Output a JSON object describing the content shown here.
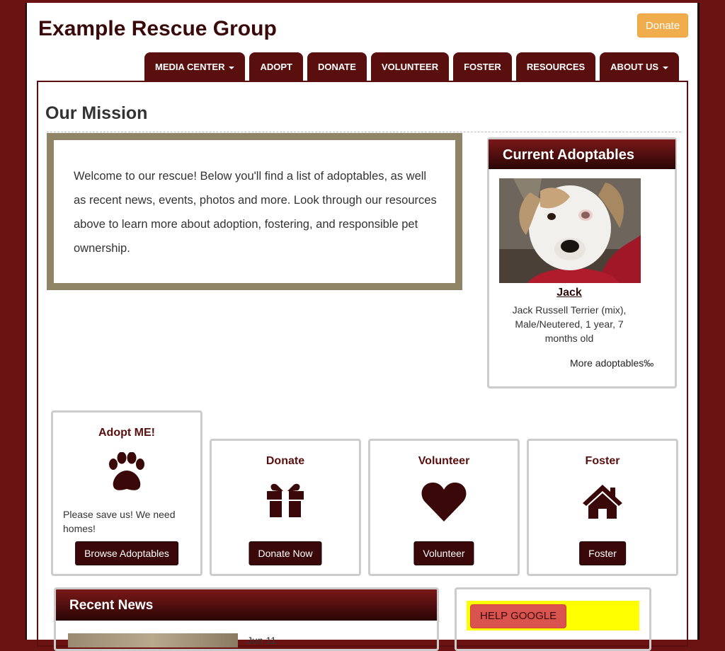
{
  "site": {
    "title": "Example Rescue Group",
    "donate_label": "Donate"
  },
  "nav": [
    {
      "label": "MEDIA CENTER",
      "dropdown": true
    },
    {
      "label": "ADOPT",
      "dropdown": false
    },
    {
      "label": "DONATE",
      "dropdown": false
    },
    {
      "label": "VOLUNTEER",
      "dropdown": false
    },
    {
      "label": "FOSTER",
      "dropdown": false
    },
    {
      "label": "RESOURCES",
      "dropdown": false
    },
    {
      "label": "ABOUT US",
      "dropdown": true
    }
  ],
  "mission": {
    "title": "Our Mission",
    "text": "Welcome to our rescue! Below you'll find a list of adoptables, as well as recent news, events, photos and more. Look through our resources above to learn more about adoption, fostering, and responsible pet ownership."
  },
  "adoptables": {
    "title": "Current Adoptables",
    "pet": {
      "name": "Jack",
      "description": "Jack Russell Terrier (mix), Male/Neutered, 1 year, 7 months old"
    },
    "more_label": "More adoptables‰"
  },
  "cards": [
    {
      "title": "Adopt ME!",
      "icon": "paw-icon",
      "text": "Please save us! We need homes!",
      "button": "Browse Adoptables"
    },
    {
      "title": "Donate",
      "icon": "gift-icon",
      "text": "",
      "button": "Donate Now"
    },
    {
      "title": "Volunteer",
      "icon": "heart-icon",
      "text": "",
      "button": "Volunteer"
    },
    {
      "title": "Foster",
      "icon": "home-icon",
      "text": "",
      "button": "Foster"
    }
  ],
  "news": {
    "title": "Recent News",
    "date_partial": "Jun 11"
  },
  "help": {
    "button": "HELP GOOGLE"
  },
  "colors": {
    "brand": "#5a0f0f",
    "background": "#6b1212",
    "donate": "#f0ad4e",
    "help_bg": "#ffff00",
    "help_btn": "#d9534f"
  }
}
